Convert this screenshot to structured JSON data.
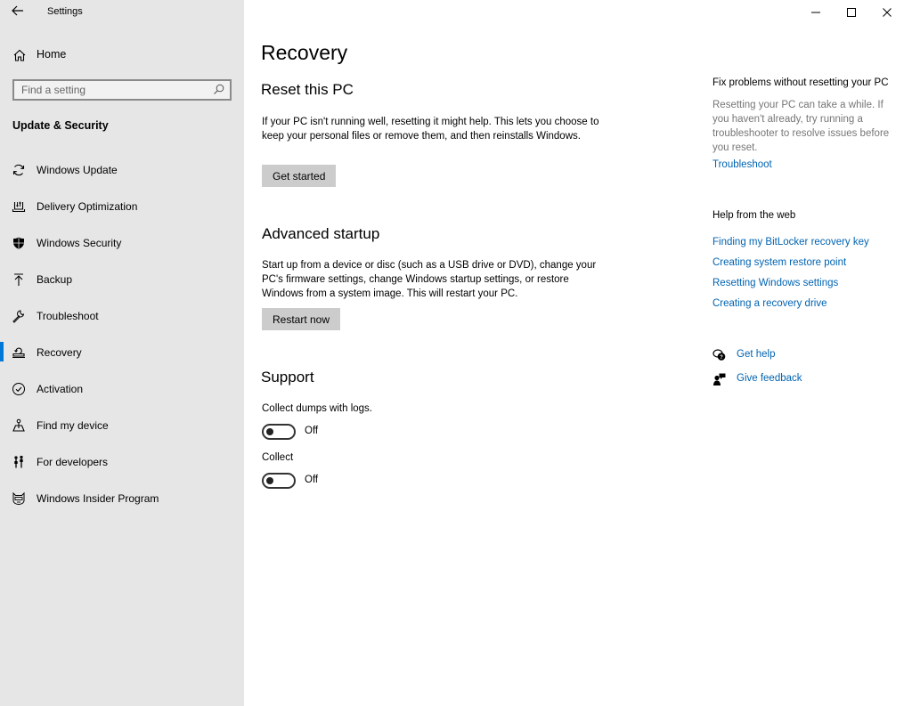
{
  "window": {
    "title": "Settings",
    "controls": {
      "minimize": "minimize-icon",
      "maximize": "maximize-icon",
      "close": "close-icon"
    }
  },
  "sidebar": {
    "home_label": "Home",
    "search_placeholder": "Find a setting",
    "search_value": "",
    "section_title": "Update & Security",
    "items": [
      {
        "label": "Windows Update",
        "icon": "sync-icon",
        "active": false
      },
      {
        "label": "Delivery Optimization",
        "icon": "delivery-optimization-icon",
        "active": false
      },
      {
        "label": "Windows Security",
        "icon": "shield-icon",
        "active": false
      },
      {
        "label": "Backup",
        "icon": "upload-arrow-icon",
        "active": false
      },
      {
        "label": "Troubleshoot",
        "icon": "wrench-icon",
        "active": false
      },
      {
        "label": "Recovery",
        "icon": "recovery-icon",
        "active": true
      },
      {
        "label": "Activation",
        "icon": "check-circle-icon",
        "active": false
      },
      {
        "label": "Find my device",
        "icon": "find-device-icon",
        "active": false
      },
      {
        "label": "For developers",
        "icon": "developer-tools-icon",
        "active": false
      },
      {
        "label": "Windows Insider Program",
        "icon": "insider-cat-icon",
        "active": false
      }
    ]
  },
  "main": {
    "title": "Recovery",
    "reset": {
      "heading": "Reset this PC",
      "description": "If your PC isn't running well, resetting it might help. This lets you choose to keep your personal files or remove them, and then reinstalls Windows.",
      "button": "Get started"
    },
    "advanced": {
      "heading": "Advanced startup",
      "description": "Start up from a device or disc (such as a USB drive or DVD), change your PC's firmware settings, change Windows startup settings, or restore Windows from a system image. This will restart your PC.",
      "button": "Restart now"
    },
    "support": {
      "heading": "Support",
      "toggles": [
        {
          "label": "Collect dumps with logs.",
          "state": "Off",
          "on": false
        },
        {
          "label": "Collect",
          "state": "Off",
          "on": false
        }
      ]
    }
  },
  "aside": {
    "fix": {
      "heading": "Fix problems without resetting your PC",
      "text": "Resetting your PC can take a while. If you haven't already, try running a troubleshooter to resolve issues before you reset.",
      "link": "Troubleshoot"
    },
    "web": {
      "heading": "Help from the web",
      "links": [
        "Finding my BitLocker recovery key",
        "Creating system restore point",
        "Resetting Windows settings",
        "Creating a recovery drive"
      ]
    },
    "get_help": "Get help",
    "give_feedback": "Give feedback"
  },
  "colors": {
    "accent": "#0078d7",
    "link": "#0063b1",
    "sidebar_bg": "#e6e6e6",
    "button_bg": "#cccccc"
  }
}
